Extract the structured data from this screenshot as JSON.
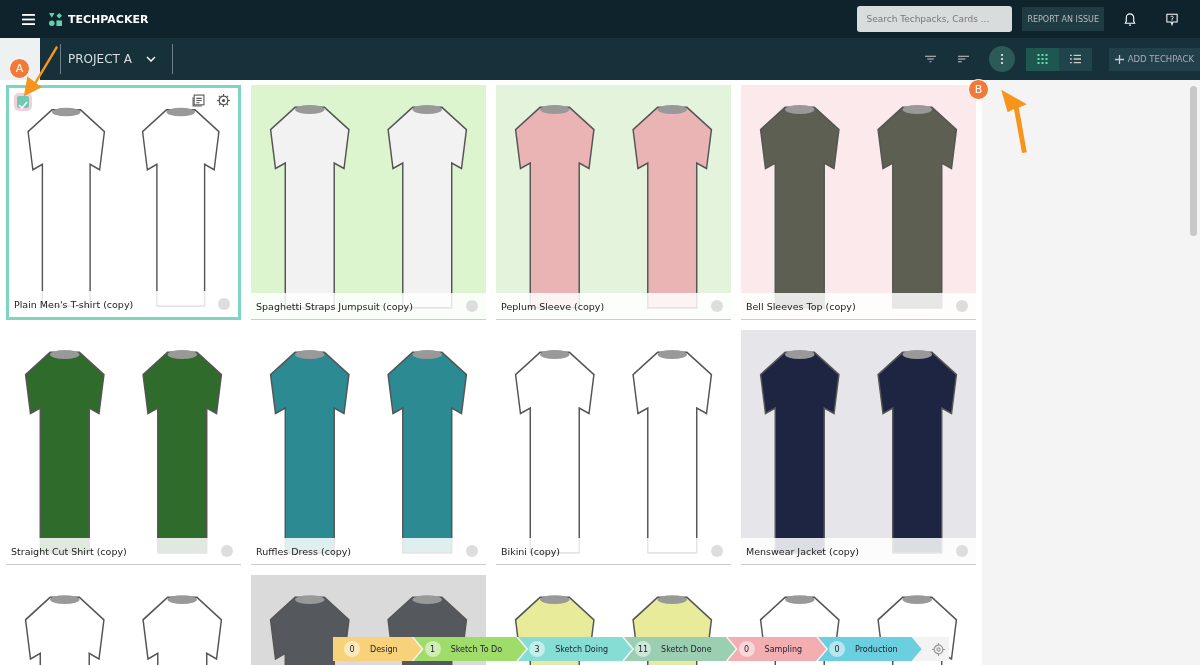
{
  "header": {
    "brand": "TECHPACKER",
    "search": {
      "placeholder": "Search Techpacks, Cards ..."
    },
    "report_button": "REPORT AN ISSUE"
  },
  "toolbar": {
    "project": "PROJECT A",
    "views": [
      {
        "kind": "grid",
        "selected": true
      },
      {
        "kind": "list",
        "selected": false
      }
    ],
    "add_button": "ADD TECHPACK"
  },
  "annotations": [
    "A",
    "B"
  ],
  "cards": [
    {
      "name": "Plain Men's T-shirt (copy)",
      "selected": true,
      "checked": true
    },
    {
      "name": "Spaghetti Straps Jumpsuit (copy)",
      "selected": false
    },
    {
      "name": "Peplum Sleeve (copy)",
      "selected": false
    },
    {
      "name": "Bell Sleeves Top (copy)",
      "selected": false
    },
    {
      "name": "Straight Cut Shirt (copy)",
      "selected": false
    },
    {
      "name": "Ruffles Dress (copy)",
      "selected": false
    },
    {
      "name": "Bikini (copy)",
      "selected": false
    },
    {
      "name": "Menswear Jacket (copy)",
      "selected": false
    },
    {
      "kind": "picture"
    },
    {
      "kind": "picture"
    },
    {
      "kind": "picture"
    },
    {
      "kind": "picture"
    }
  ],
  "stages": [
    {
      "count": "0",
      "label": "Design",
      "color": "#f7d27a"
    },
    {
      "count": "1",
      "label": "Sketch To Do",
      "color": "#9fdc6a"
    },
    {
      "count": "3",
      "label": "Sketch Doing",
      "color": "#86ddd3"
    },
    {
      "count": "11",
      "label": "Sketch Done",
      "color": "#9ccfb2"
    },
    {
      "count": "0",
      "label": "Sampling",
      "color": "#f3aeb2"
    },
    {
      "count": "0",
      "label": "Production",
      "color": "#6ccfe0"
    }
  ]
}
